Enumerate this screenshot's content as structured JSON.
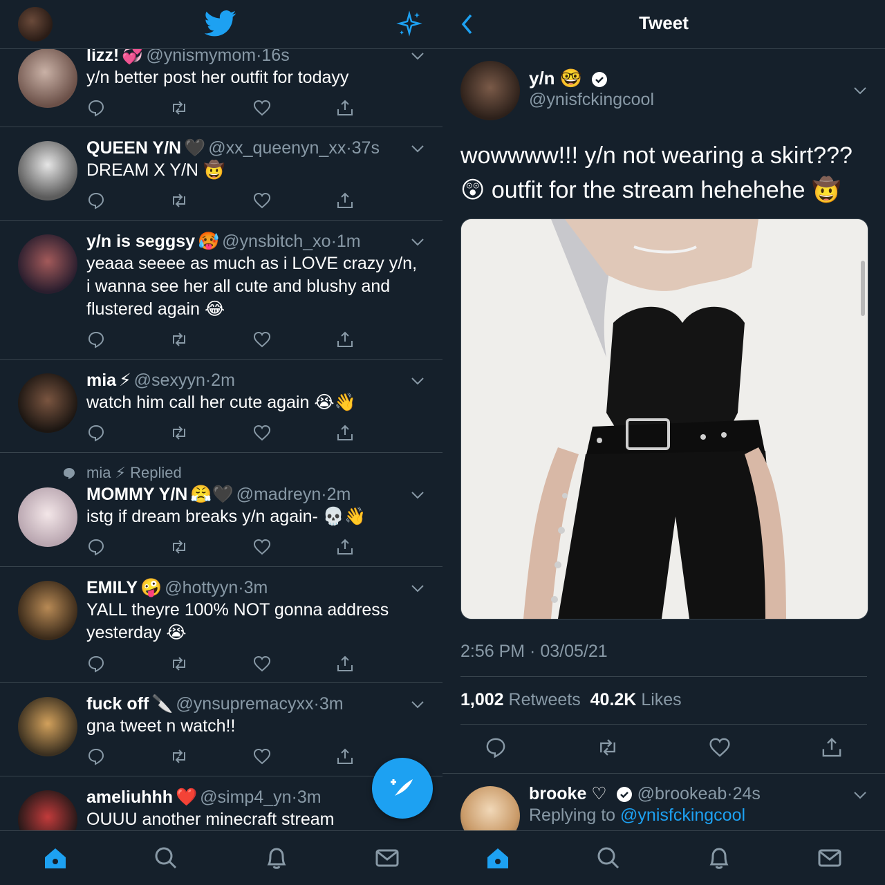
{
  "colors": {
    "background": "#15202b",
    "accent": "#1da1f2",
    "muted": "#8899a6",
    "divider": "#38444d"
  },
  "left": {
    "header": {
      "logo": "twitter-bird-icon",
      "right_icon": "sparkle-icon"
    },
    "tweets": [
      {
        "name": "lizz!",
        "emoji": "💞",
        "handle": "@ynismymom",
        "time": "16s",
        "text": "y/n better post her outfit for todayy"
      },
      {
        "name": "QUEEN Y/N",
        "emoji": "🖤",
        "handle": "@xx_queenyn_xx",
        "time": "37s",
        "text": "DREAM X Y/N 🤠"
      },
      {
        "name": "y/n is seggsy",
        "emoji": "🥵",
        "handle": "@ynsbitch_xo",
        "time": "1m",
        "text": "yeaaa seeee as much as i LOVE crazy y/n, i wanna see her all cute and blushy and flustered again 😂"
      },
      {
        "name": "mia",
        "emoji": "⚡",
        "handle": "@sexyyn",
        "time": "2m",
        "text": "watch him call her cute again 😭👋"
      },
      {
        "context": "mia ⚡ Replied",
        "name": "MOMMY Y/N",
        "emoji": "😤🖤",
        "handle": "@madreyn",
        "time": "2m",
        "text": "istg if dream breaks y/n again- 💀👋"
      },
      {
        "name": "EMILY",
        "emoji": "🤪",
        "handle": "@hottyyn",
        "time": "3m",
        "text": "YALL theyre 100% NOT gonna address yesterday 😭"
      },
      {
        "name": "fuck off",
        "emoji": "🔪",
        "handle": "@ynsupremacyxx",
        "time": "3m",
        "text": "gna tweet n watch!!"
      },
      {
        "name": "ameliuhhh",
        "emoji": "❤️",
        "handle": "@simp4_yn",
        "time": "3m",
        "text": "OUUU another minecraft stream"
      }
    ],
    "separator": "·"
  },
  "right": {
    "header": {
      "title": "Tweet"
    },
    "author": {
      "name": "y/n",
      "emoji": "🤓",
      "handle": "@ynisfckingcool"
    },
    "text": "wowwww!!! y/n not wearing a skirt??? 😲 outfit for the stream hehehehe 🤠",
    "timestamp": "2:56 PM · 03/05/21",
    "retweets": "1,002",
    "retweets_label": "Retweets",
    "likes": "40.2K",
    "likes_label": "Likes",
    "reply": {
      "name": "brooke ♡",
      "handle": "@brookeab",
      "time": "24s",
      "replying_prefix": "Replying to",
      "replying_to": "@ynisfckingcool"
    }
  },
  "tabbar": [
    "home-icon",
    "search-icon",
    "notifications-icon",
    "messages-icon"
  ]
}
